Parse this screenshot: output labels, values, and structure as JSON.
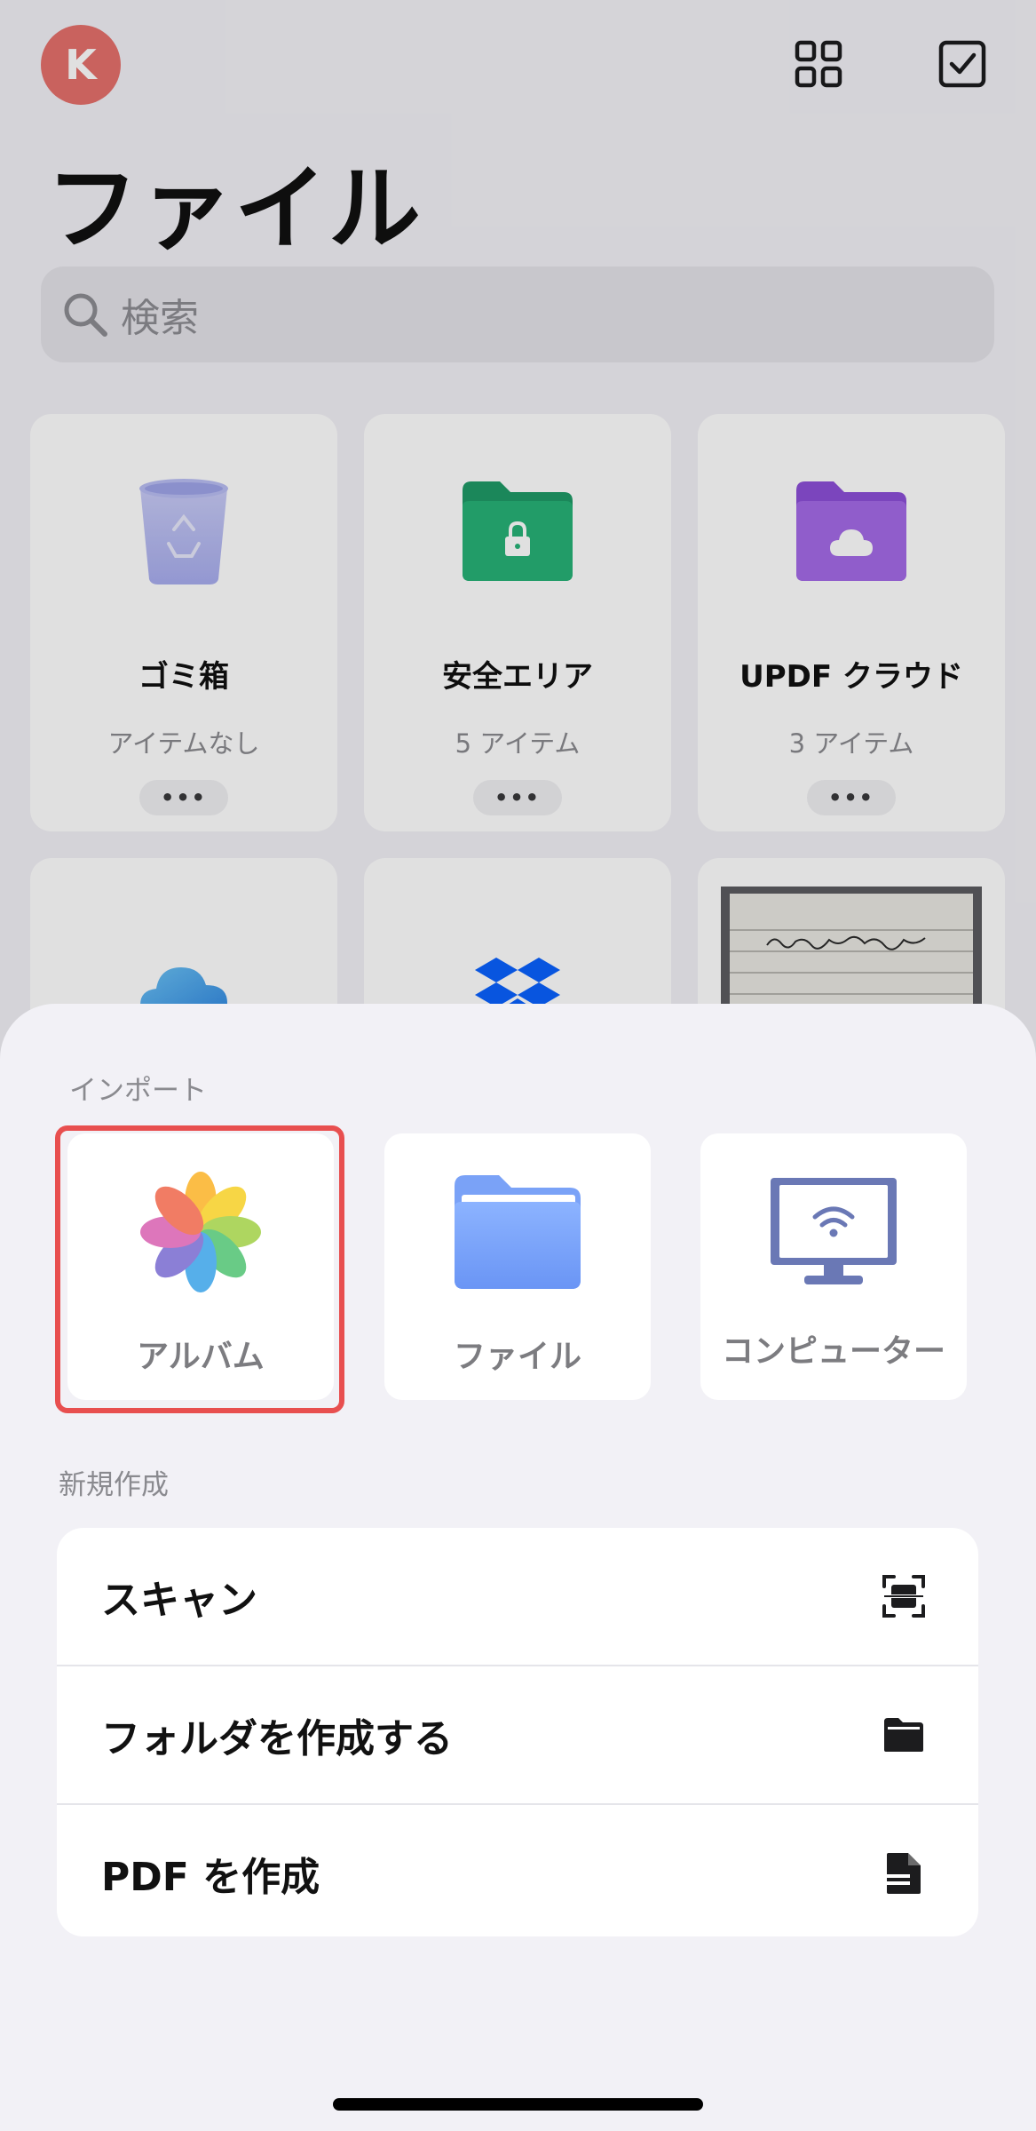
{
  "header": {
    "avatar_letter": "K",
    "title": "ファイル"
  },
  "search": {
    "placeholder": "検索"
  },
  "tiles": [
    {
      "name": "ゴミ箱",
      "subtitle": "アイテムなし",
      "icon": "trash-icon"
    },
    {
      "name": "安全エリア",
      "subtitle": "5 アイテム",
      "icon": "secure-folder-icon"
    },
    {
      "name": "UPDF クラウド",
      "subtitle": "3 アイテム",
      "icon": "cloud-folder-icon"
    },
    {
      "name": "",
      "subtitle": "",
      "icon": "icloud-icon"
    },
    {
      "name": "",
      "subtitle": "",
      "icon": "dropbox-icon"
    },
    {
      "name": "",
      "subtitle": "",
      "icon": "document-thumbnail"
    }
  ],
  "more_label": "•••",
  "sheet": {
    "import_label": "インポート",
    "import_options": [
      {
        "label": "アルバム",
        "icon": "photos-icon"
      },
      {
        "label": "ファイル",
        "icon": "folder-icon"
      },
      {
        "label": "コンピューター",
        "icon": "computer-wifi-icon"
      }
    ],
    "new_label": "新規作成",
    "actions": [
      {
        "label": "スキャン",
        "icon": "scan-icon"
      },
      {
        "label": "フォルダを作成する",
        "icon": "folder-add-icon"
      },
      {
        "label": "PDF を作成",
        "icon": "pdf-create-icon"
      }
    ]
  },
  "colors": {
    "avatar": "#e5706c",
    "highlight": "#e84f4f",
    "secure_folder": "#22a870",
    "cloud_folder": "#9b5fe0"
  }
}
